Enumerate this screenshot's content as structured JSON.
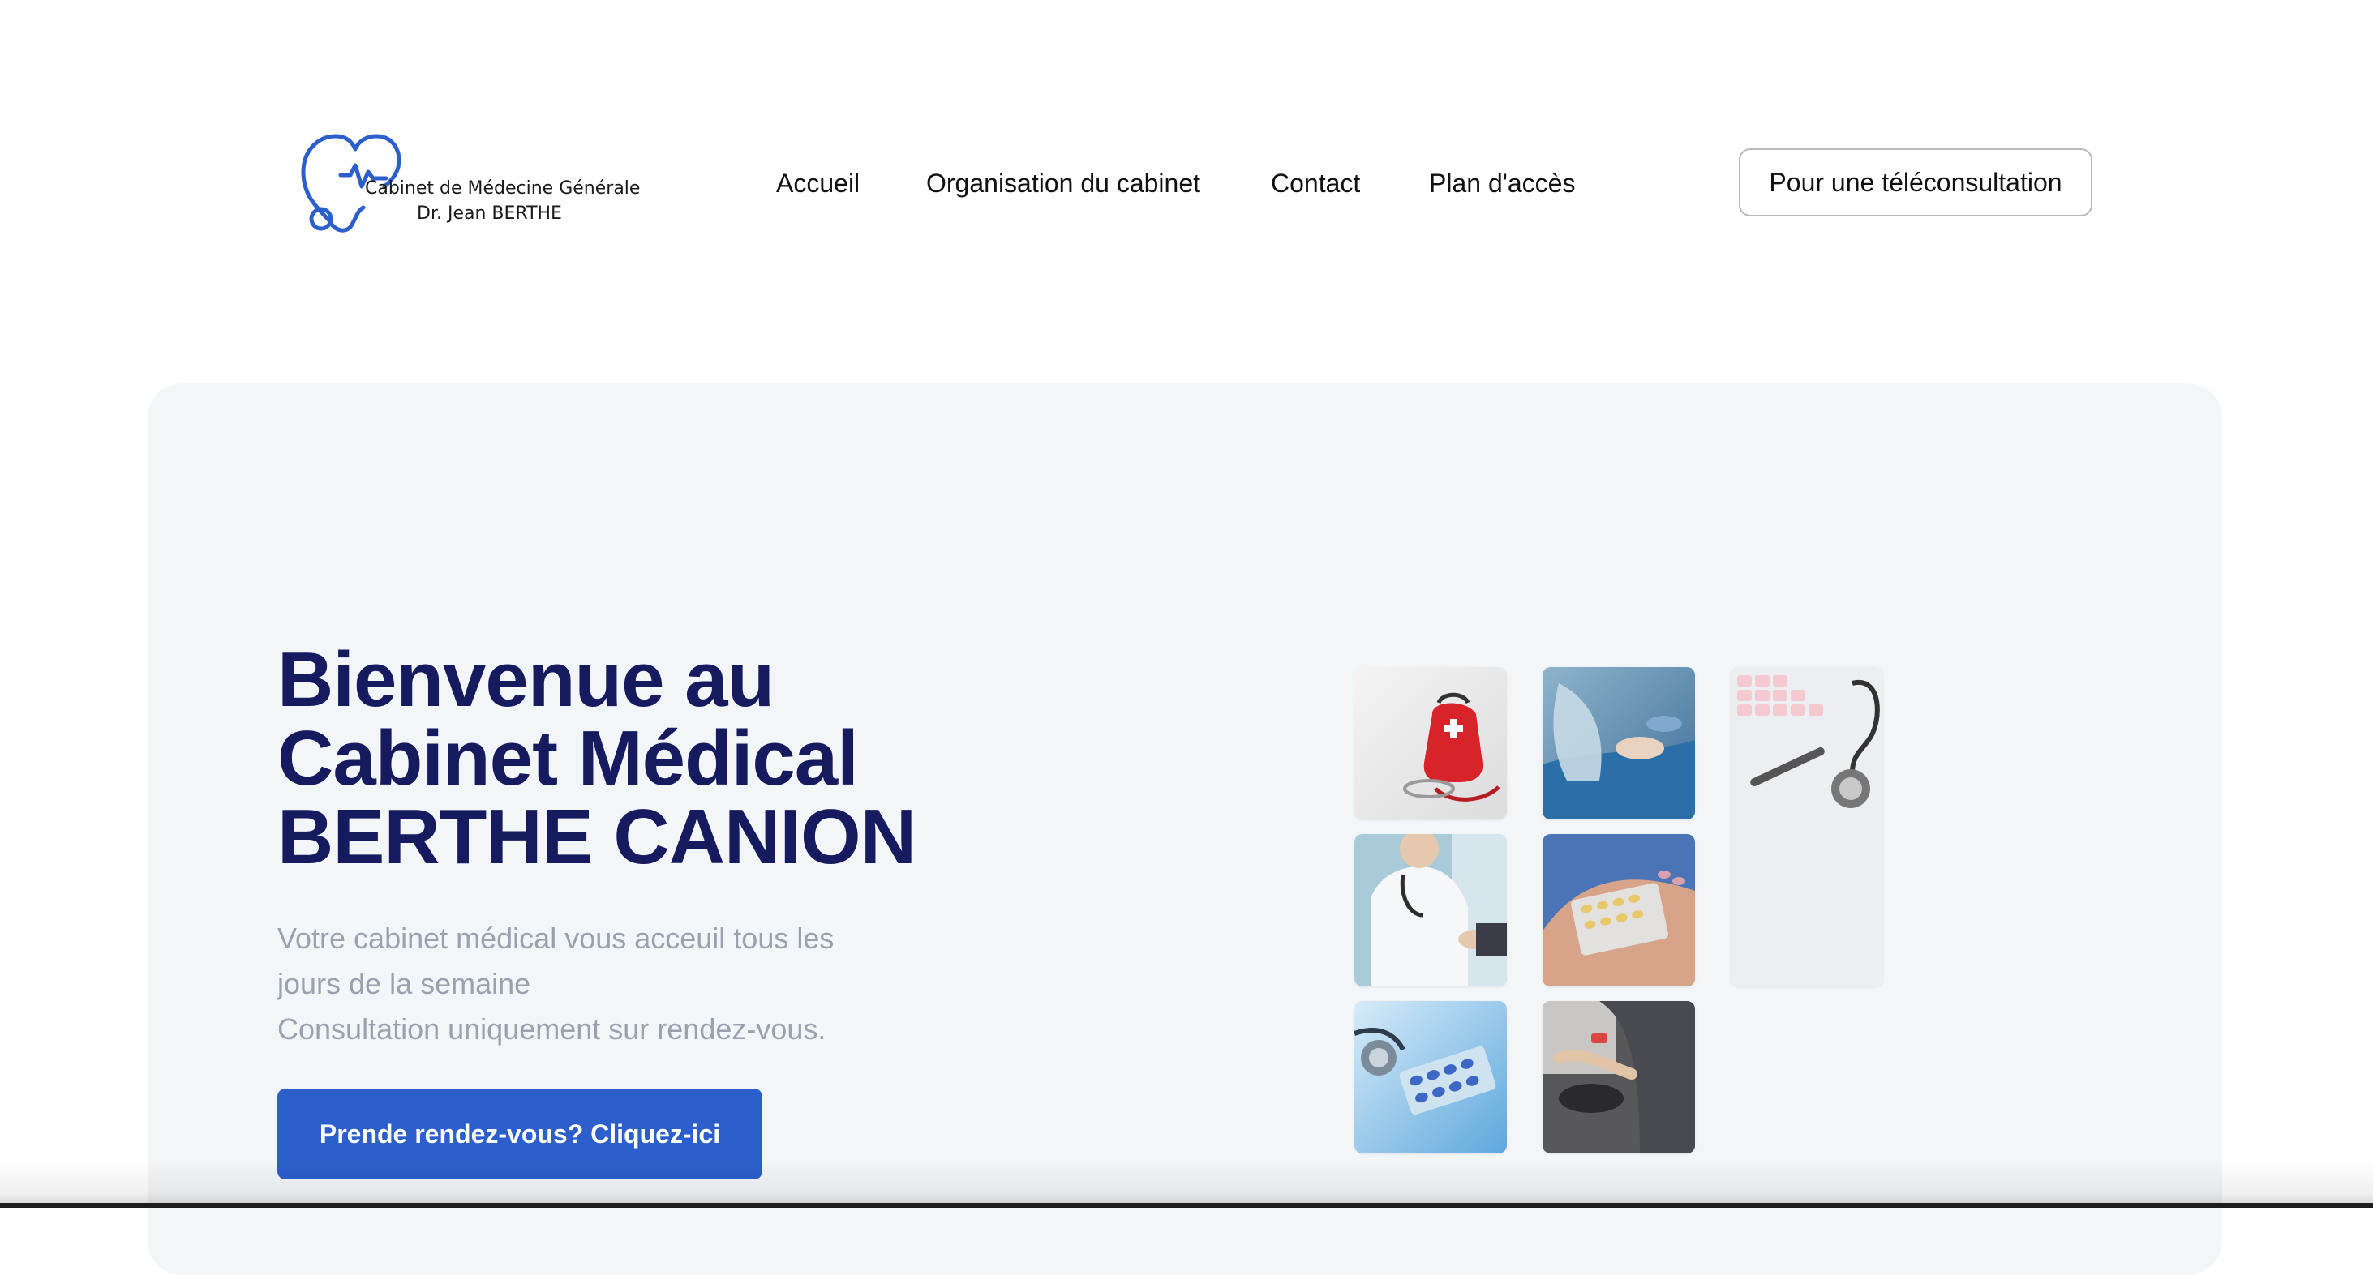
{
  "brand": {
    "line1": "Cabinet de Médecine Générale",
    "line2": "Dr.  Jean BERTHE",
    "logo_icon": "heart-stethoscope-icon",
    "color": "#2c5fcb"
  },
  "nav": {
    "items": [
      {
        "label": "Accueil"
      },
      {
        "label": "Organisation du cabinet"
      },
      {
        "label": "Contact"
      },
      {
        "label": "Plan d'accès"
      }
    ],
    "cta_label": "Pour une téléconsultation"
  },
  "hero": {
    "title_lines": [
      "Bienvenue au",
      "Cabinet Médical",
      "BERTHE CANION"
    ],
    "subtitle_lines": [
      "Votre cabinet médical vous acceuil tous les",
      "jours de la semaine",
      "Consultation uniquement sur rendez-vous."
    ],
    "button_label": "Prende rendez-vous? Cliquez-ici",
    "title_color": "#161a5e",
    "button_color": "#2c5fcb"
  },
  "gallery": {
    "images": [
      "first-aid-kit-photo",
      "surgery-photo",
      "keyboard-stethoscope-photo",
      "doctor-handshake-photo",
      "pills-in-hand-photo",
      "stethoscope-pills-photo",
      "blood-pressure-photo"
    ]
  }
}
